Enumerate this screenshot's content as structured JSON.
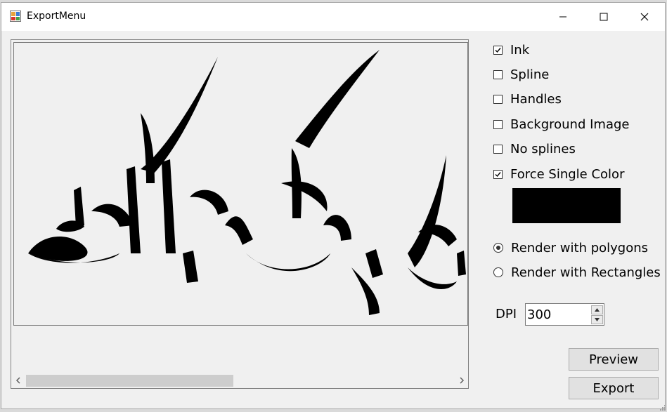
{
  "window": {
    "title": "ExportMenu",
    "app_icon": "app-form-icon",
    "controls": [
      "minimize-icon",
      "maximize-icon",
      "close-icon"
    ]
  },
  "options": {
    "ink": {
      "label": "Ink",
      "checked": true
    },
    "spline": {
      "label": "Spline",
      "checked": false
    },
    "handles": {
      "label": "Handles",
      "checked": false
    },
    "background_image": {
      "label": "Background Image",
      "checked": false
    },
    "no_splines": {
      "label": "No splines",
      "checked": false
    },
    "force_single_color": {
      "label": "Force Single Color",
      "checked": true
    }
  },
  "single_color": "#000000",
  "render_mode": {
    "polygons": {
      "label": "Render with polygons",
      "selected": true
    },
    "rectangles": {
      "label": "Render with Rectangles",
      "selected": false
    }
  },
  "dpi": {
    "label": "DPI",
    "value": "300"
  },
  "buttons": {
    "preview": "Preview",
    "export": "Export"
  },
  "preview": {
    "ink_color": "#000000",
    "scroll_position": 0
  }
}
